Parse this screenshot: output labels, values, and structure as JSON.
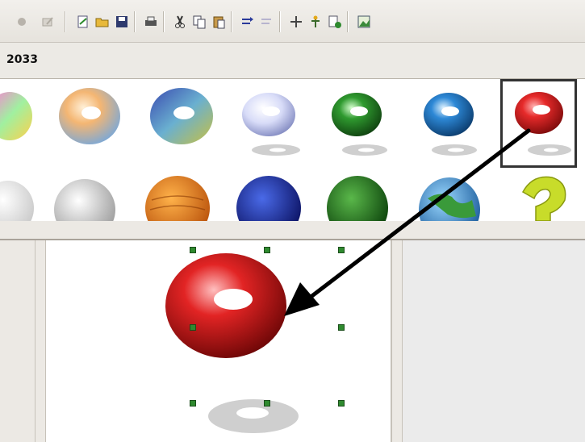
{
  "toolbar": {
    "icons": [
      "record-icon",
      "edit-icon",
      "new-document-icon",
      "open-folder-icon",
      "save-icon",
      "print-icon",
      "cut-icon",
      "copy-icon",
      "paste-icon",
      "align-icon",
      "redo-icon",
      "move-icon",
      "tree-icon",
      "export-icon",
      "image-icon"
    ]
  },
  "label_bar": {
    "text": "2033"
  },
  "gallery": {
    "row1": [
      "rainbow-torus",
      "peach-torus",
      "blue-yellow-torus",
      "white-torus",
      "green-torus",
      "blue-torus",
      "red-torus"
    ],
    "row2": [
      "white-sphere",
      "gray-sphere",
      "orange-textured-sphere",
      "blue-textured-sphere",
      "green-textured-sphere",
      "earth-globe",
      "yellow-question-mark"
    ],
    "selected": "red-torus"
  },
  "colors": {
    "accent_red": "#d81818",
    "handle_green": "#2f8a2f"
  }
}
